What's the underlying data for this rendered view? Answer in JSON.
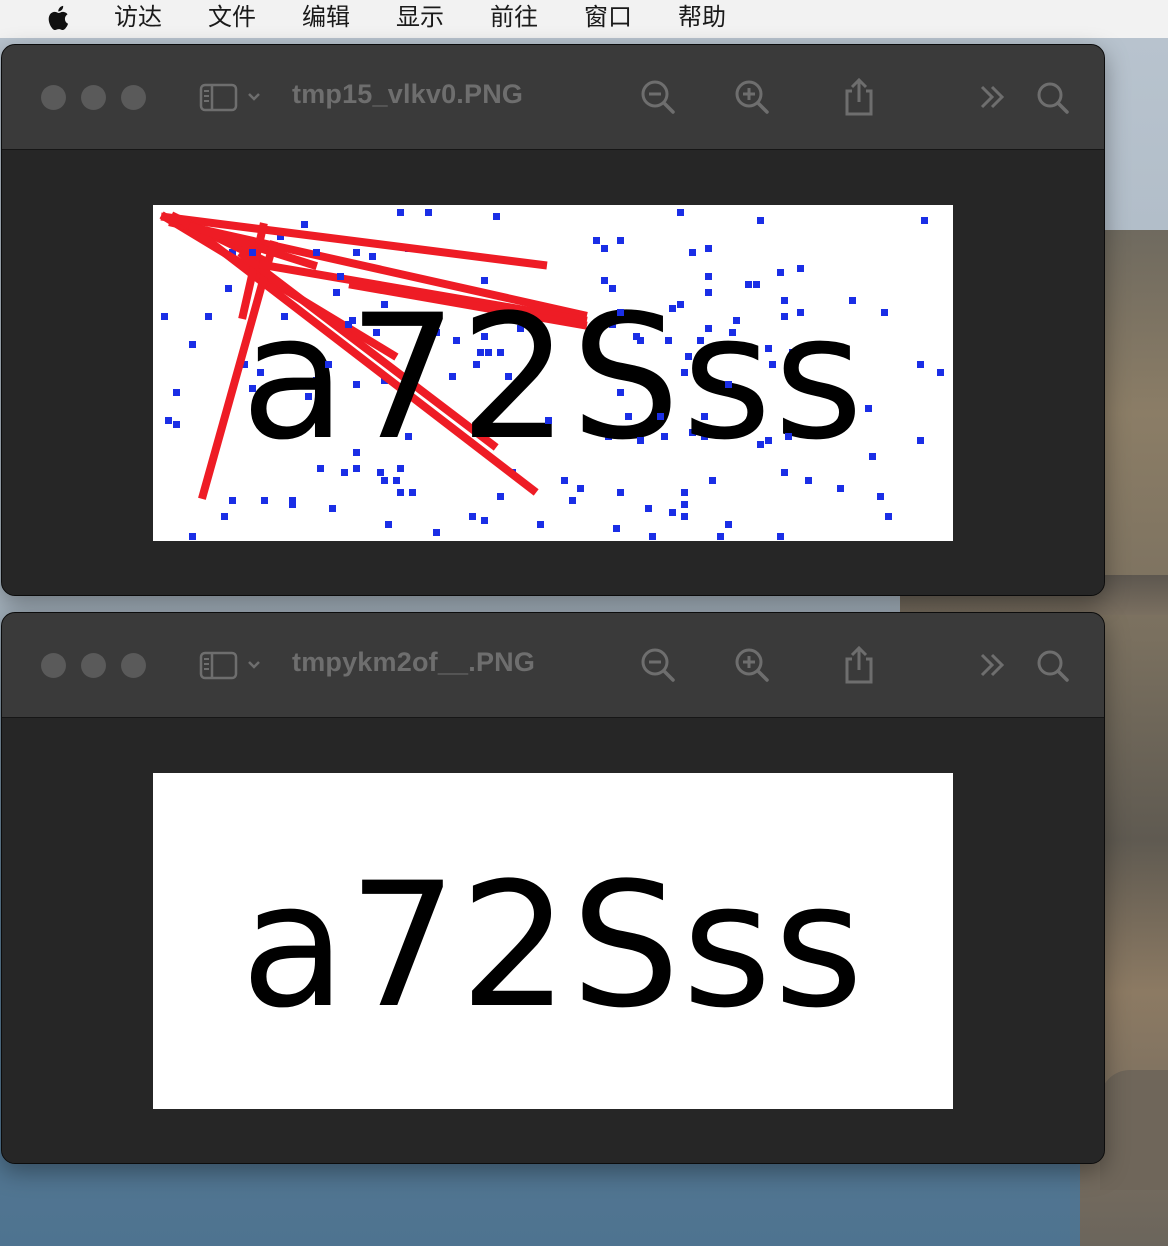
{
  "menubar": {
    "apple_icon": "apple-icon",
    "items": [
      "访达",
      "文件",
      "编辑",
      "显示",
      "前往",
      "窗口",
      "帮助"
    ]
  },
  "windows": [
    {
      "title": "tmp15_vlkv0.PNG",
      "image_text": "a72Sss",
      "image_variant": "noisy captcha with red lines and blue dots"
    },
    {
      "title": "tmpykm2of__.PNG",
      "image_text": "a72Sss",
      "image_variant": "clean captcha"
    }
  ],
  "toolbar_icons": [
    "sidebar-icon",
    "chevron-down-icon",
    "zoom-out-icon",
    "zoom-in-icon",
    "share-icon",
    "more-chevrons-icon",
    "search-icon"
  ],
  "colors": {
    "noise_red": "#ee1c25",
    "noise_blue": "#1a2ee6",
    "text_black": "#000000",
    "window_bg": "#262626",
    "titlebar_bg": "#3a3a3a"
  }
}
